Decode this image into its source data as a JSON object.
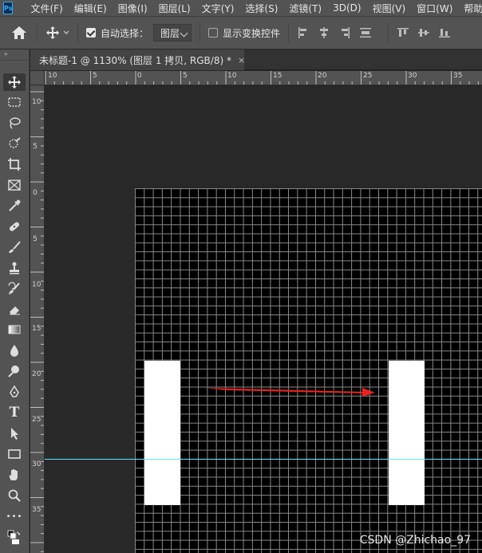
{
  "app": {
    "logo": "Ps"
  },
  "menu": [
    "文件(F)",
    "编辑(E)",
    "图像(I)",
    "图层(L)",
    "文字(Y)",
    "选择(S)",
    "滤镜(T)",
    "3D(D)",
    "视图(V)",
    "窗口(W)",
    "帮助"
  ],
  "options": {
    "auto_select_label": "自动选择：",
    "auto_select_checked": true,
    "target_value": "图层",
    "show_transform_label": "显示变换控件",
    "show_transform_checked": false
  },
  "toolbar": {
    "collapse_glyph": "»",
    "tools": [
      "move-tool-icon",
      "marquee-tool-icon",
      "lasso-tool-icon",
      "quick-select-tool-icon",
      "crop-tool-icon",
      "frame-tool-icon",
      "eyedropper-tool-icon",
      "healing-brush-icon",
      "brush-tool-icon",
      "clone-stamp-icon",
      "history-brush-icon",
      "eraser-tool-icon",
      "gradient-tool-icon",
      "blur-tool-icon",
      "dodge-tool-icon",
      "pen-tool-icon",
      "type-tool-icon",
      "path-select-icon",
      "rectangle-tool-icon",
      "hand-tool-icon",
      "zoom-tool-icon",
      "more-tools-icon",
      "color-swatches-icon"
    ],
    "type_glyph": "T",
    "more_glyph": "•••"
  },
  "document": {
    "tab_title": "未标题-1 @ 1130% (图层 1 拷贝, RGB/8) *",
    "close_glyph": "×"
  },
  "ruler": {
    "top_labels": [
      "10",
      "5",
      "0",
      "5",
      "10",
      "15",
      "20",
      "25",
      "30",
      "35"
    ],
    "left_labels": [
      "10",
      "5",
      "0",
      "5",
      "10",
      "15",
      "20",
      "25",
      "30",
      "35"
    ]
  },
  "colors": {
    "guide": "#5fe2f3",
    "arrow": "#e8231f",
    "canvas": "#000000",
    "grid": "#8a8a8a"
  },
  "watermark": "CSDN @Zhichao_97"
}
